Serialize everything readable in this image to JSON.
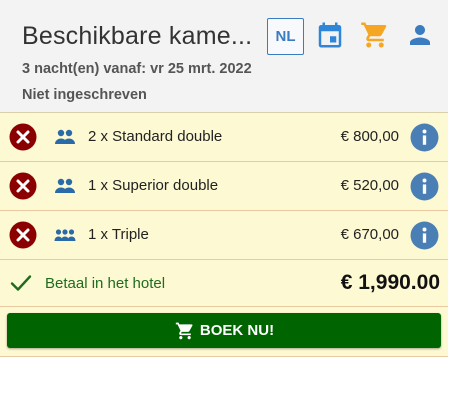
{
  "header": {
    "title": "Beschikbare kame...",
    "subtitle": "3 nacht(en) vanaf: vr 25 mrt. 2022",
    "status": "Niet ingeschreven",
    "language": "NL"
  },
  "icons": {
    "calendar": "calendar-icon",
    "cart": "cart-icon",
    "user": "user-icon",
    "remove": "remove-icon",
    "info": "info-icon",
    "check": "check-icon"
  },
  "rooms": [
    {
      "label": "2 x Standard double",
      "price": "€ 800,00",
      "occupancy_icon": "two-people-icon"
    },
    {
      "label": "1 x Superior double",
      "price": "€ 520,00",
      "occupancy_icon": "two-people-icon"
    },
    {
      "label": "1 x Triple",
      "price": "€ 670,00",
      "occupancy_icon": "three-people-icon"
    }
  ],
  "summary": {
    "pay_label": "Betaal in het hotel",
    "total": "€ 1,990.00"
  },
  "actions": {
    "book_label": "BOEK NU!"
  },
  "colors": {
    "header_bg": "#f3f3f3",
    "row_bg": "#fdf9d3",
    "accent_blue": "#3b7bbf",
    "cart_orange": "#f5a623",
    "remove_red": "#8b0000",
    "info_blue": "#4a7fb5",
    "book_green": "#006400"
  }
}
